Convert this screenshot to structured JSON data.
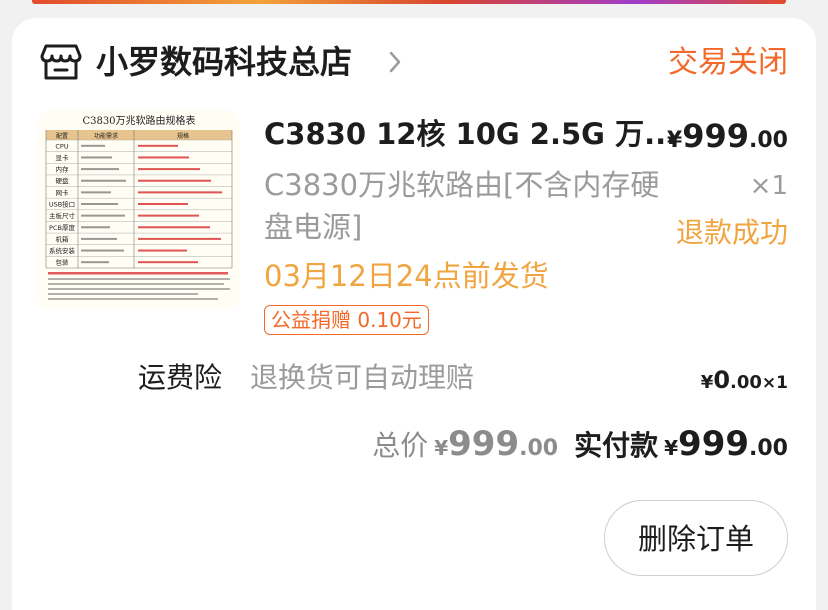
{
  "store": {
    "name": "小罗数码科技总店",
    "status": "交易关闭"
  },
  "item": {
    "thumbnail": {
      "title": "C3830万兆软路由规格表",
      "headers": [
        "配置",
        "功能需求",
        "规格"
      ],
      "row_labels": [
        "CPU",
        "显卡",
        "内存",
        "硬盘",
        "网卡",
        "USB接口",
        "主板尺寸",
        "PCB厚度",
        "机箱",
        "系统安装",
        "包装"
      ]
    },
    "title": "C3830 12核 10G 2.5G 万...",
    "price": {
      "currency": "¥",
      "integer": "999",
      "decimal": ".00"
    },
    "sku": "C3830万兆软路由[不含内存硬盘电源]",
    "quantity": "×1",
    "refund_status": "退款成功",
    "shipping_note": "03月12日24点前发货",
    "charity": "公益捐赠 0.10元"
  },
  "insurance": {
    "label": "运费险",
    "desc": "退换货可自动理赔",
    "price": {
      "currency": "¥",
      "integer": "0",
      "decimal": ".00",
      "qty": "×1"
    }
  },
  "totals": {
    "total_label": "总价",
    "total": {
      "currency": "¥",
      "integer": "999",
      "decimal": ".00"
    },
    "paid_label": "实付款",
    "paid": {
      "currency": "¥",
      "integer": "999",
      "decimal": ".00"
    }
  },
  "actions": {
    "delete_label": "删除订单"
  },
  "colors": {
    "accent": "#f2692a",
    "secondary_accent": "#f0a540",
    "text": "#1d1d1d",
    "muted": "#9b9b9b"
  },
  "icons": {
    "store": "store-icon",
    "chevron": "chevron-right-icon"
  }
}
